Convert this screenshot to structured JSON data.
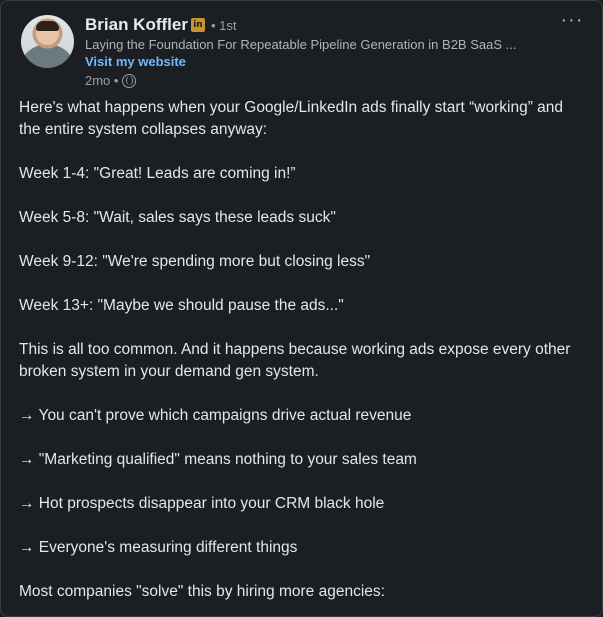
{
  "author": {
    "name": "Brian Koffler",
    "badge": "in",
    "degree": "• 1st",
    "headline": "Laying the Foundation For Repeatable Pipeline Generation in B2B SaaS ...",
    "website_label": "Visit my website",
    "time": "2mo •"
  },
  "menu": {
    "label": "···"
  },
  "body": {
    "paragraphs": [
      "Here's what happens when your Google/LinkedIn ads finally start “working” and the entire system collapses anyway:",
      "Week 1-4: \"Great! Leads are coming in!”",
      "Week 5-8: \"Wait, sales says these leads suck\"",
      "Week 9-12: \"We're spending more but closing less\"",
      "Week 13+: \"Maybe we should pause the ads...\"",
      "This is all too common. And it happens because working ads expose every other broken system in your demand gen system.",
      "→ You can't prove which campaigns drive actual revenue",
      "→ \"Marketing qualified\" means nothing to your sales team",
      "→ Hot prospects disappear into your CRM black hole",
      "→ Everyone's measuring different things",
      "Most companies \"solve\" this by hiring more agencies:"
    ]
  },
  "colors": {
    "background": "#1b1f23",
    "text": "#e6e6e6",
    "link": "#71b7fb",
    "badge": "#c8942b"
  },
  "icons": [
    "avatar",
    "linkedin-premium-badge",
    "globe-icon",
    "more-options-icon"
  ]
}
